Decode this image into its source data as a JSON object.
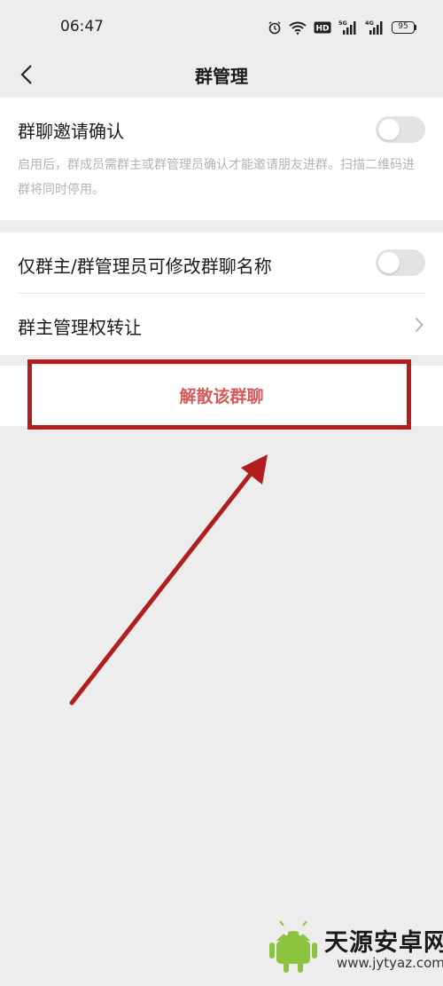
{
  "status_bar": {
    "time": "06:47",
    "battery": "95",
    "icons": [
      "alarm-icon",
      "wifi-icon",
      "hd-icon",
      "signal-5g-icon",
      "signal-4g-icon",
      "battery-icon"
    ]
  },
  "nav": {
    "title": "群管理",
    "back_icon": "back-arrow-icon"
  },
  "settings": {
    "invite_confirm": {
      "label": "群聊邀请确认",
      "description": "启用后，群成员需群主或群管理员确认才能邀请朋友进群。扫描二维码进群将同时停用。",
      "enabled": false
    },
    "owner_only_rename": {
      "label": "仅群主/群管理员可修改群聊名称",
      "enabled": false
    },
    "transfer_owner": {
      "label": "群主管理权转让"
    }
  },
  "dissolve_button": {
    "label": "解散该群聊",
    "color": "#d45a5a"
  },
  "annotation": {
    "box_color": "#b01e1e",
    "arrow_color": "#b01e1e"
  },
  "watermark": {
    "name": "天源安卓网",
    "url": "www.jytyaz.com"
  },
  "colors": {
    "background": "#ededed",
    "card": "#ffffff",
    "toggle_off": "#e3e3e3",
    "description_text": "#b3b3b3"
  }
}
